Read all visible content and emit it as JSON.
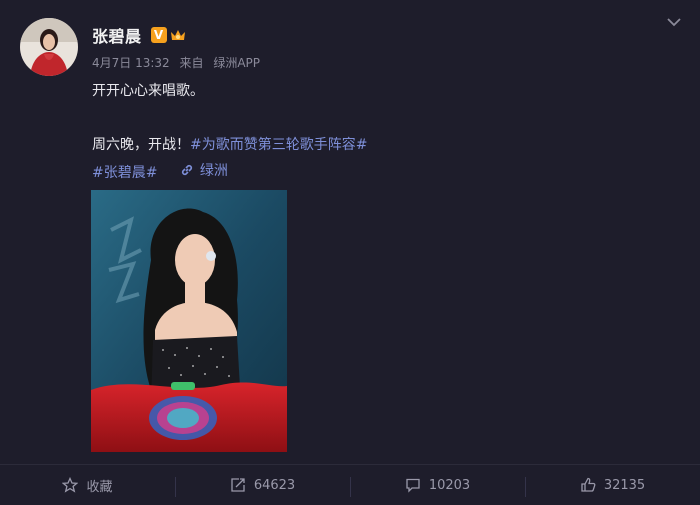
{
  "post": {
    "author": "张碧晨",
    "date": "4月7日 13:32",
    "source_prefix": "来自",
    "source": "绿洲APP",
    "text_line1": "开开心心来唱歌。",
    "text_line2_plain": "周六晚，开战！",
    "text_line2_tag": "#为歌而赞第三轮歌手阵容#",
    "text_line3_tag": "#张碧晨#",
    "link_label": "绿洲"
  },
  "actions": {
    "favorite_label": "收藏",
    "repost_count": "64623",
    "comment_count": "10203",
    "like_count": "32135"
  },
  "colors": {
    "background": "#1e1d2b",
    "tag": "#7e8fd8",
    "verified_badge": "#f6a11e"
  },
  "icons": [
    "chevron-down-icon",
    "verified-icon",
    "crown-icon",
    "link-icon",
    "star-icon",
    "repost-icon",
    "comment-icon",
    "like-icon"
  ]
}
